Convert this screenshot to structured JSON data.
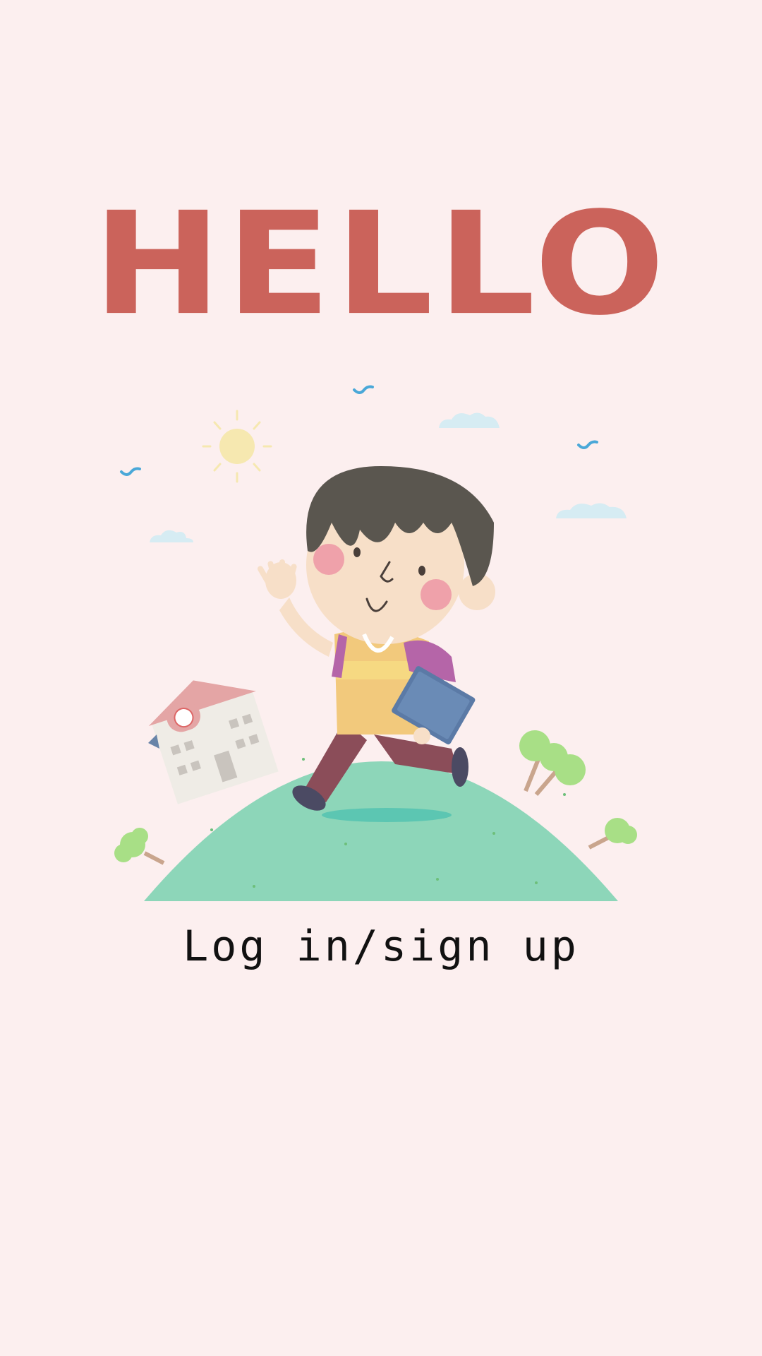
{
  "greeting": {
    "title": "HELLO"
  },
  "illustration": {
    "subject": "boy walking to school on green hill",
    "icons": [
      "sun-icon",
      "bird-icon",
      "cloud-icon",
      "school-building-icon",
      "tree-icon",
      "book-icon"
    ]
  },
  "auth": {
    "login_label": "Log in/sign up"
  },
  "colors": {
    "background": "#fcefef",
    "title": "#cb635b",
    "hill": "#8dd6b9",
    "text": "#111111"
  }
}
